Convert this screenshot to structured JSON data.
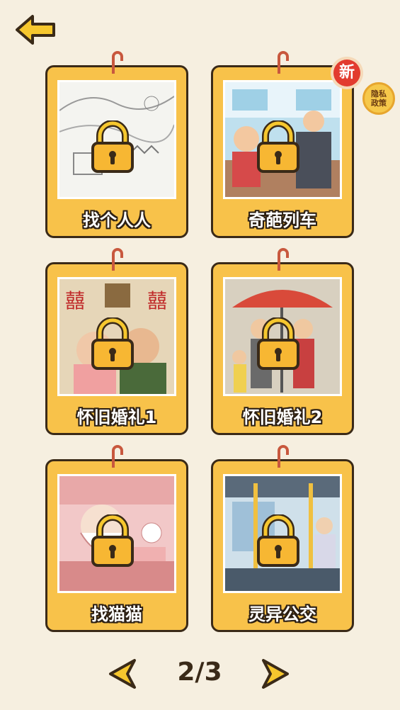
{
  "privacy_button": {
    "label": "隐私\n政策"
  },
  "levels": [
    {
      "title": "找个人人",
      "locked": true,
      "is_new": false
    },
    {
      "title": "奇葩列车",
      "locked": true,
      "is_new": true
    },
    {
      "title": "怀旧婚礼1",
      "locked": true,
      "is_new": false
    },
    {
      "title": "怀旧婚礼2",
      "locked": true,
      "is_new": false
    },
    {
      "title": "找猫猫",
      "locked": true,
      "is_new": false
    },
    {
      "title": "灵异公交",
      "locked": true,
      "is_new": false
    }
  ],
  "new_badge": {
    "label": "新"
  },
  "pager": {
    "current": "2",
    "separator": "/",
    "total": "3",
    "text": "2/3"
  },
  "colors": {
    "background": "#f6efe0",
    "card": "#f8c24a",
    "outline": "#3a2a18",
    "badge": "#e23b2e",
    "arrow": "#f6c72e"
  }
}
